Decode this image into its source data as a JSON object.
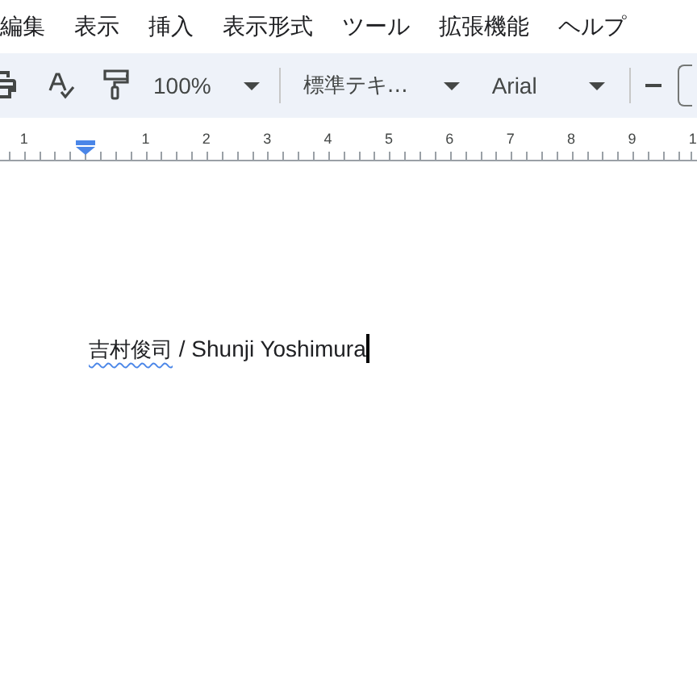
{
  "menu": [
    "編集",
    "表示",
    "挿入",
    "表示形式",
    "ツール",
    "拡張機能",
    "ヘルプ"
  ],
  "toolbar": {
    "zoom": "100%",
    "style": "標準テキ…",
    "font": "Arial"
  },
  "ruler": {
    "left_label": "1",
    "labels": [
      "1",
      "2",
      "3",
      "4",
      "5",
      "6",
      "7",
      "8",
      "9",
      "1"
    ]
  },
  "document": {
    "line": [
      {
        "text": "吉村俊司",
        "misspelled": true
      },
      {
        "text": " / Shunji Yoshimura",
        "misspelled": false
      }
    ]
  }
}
